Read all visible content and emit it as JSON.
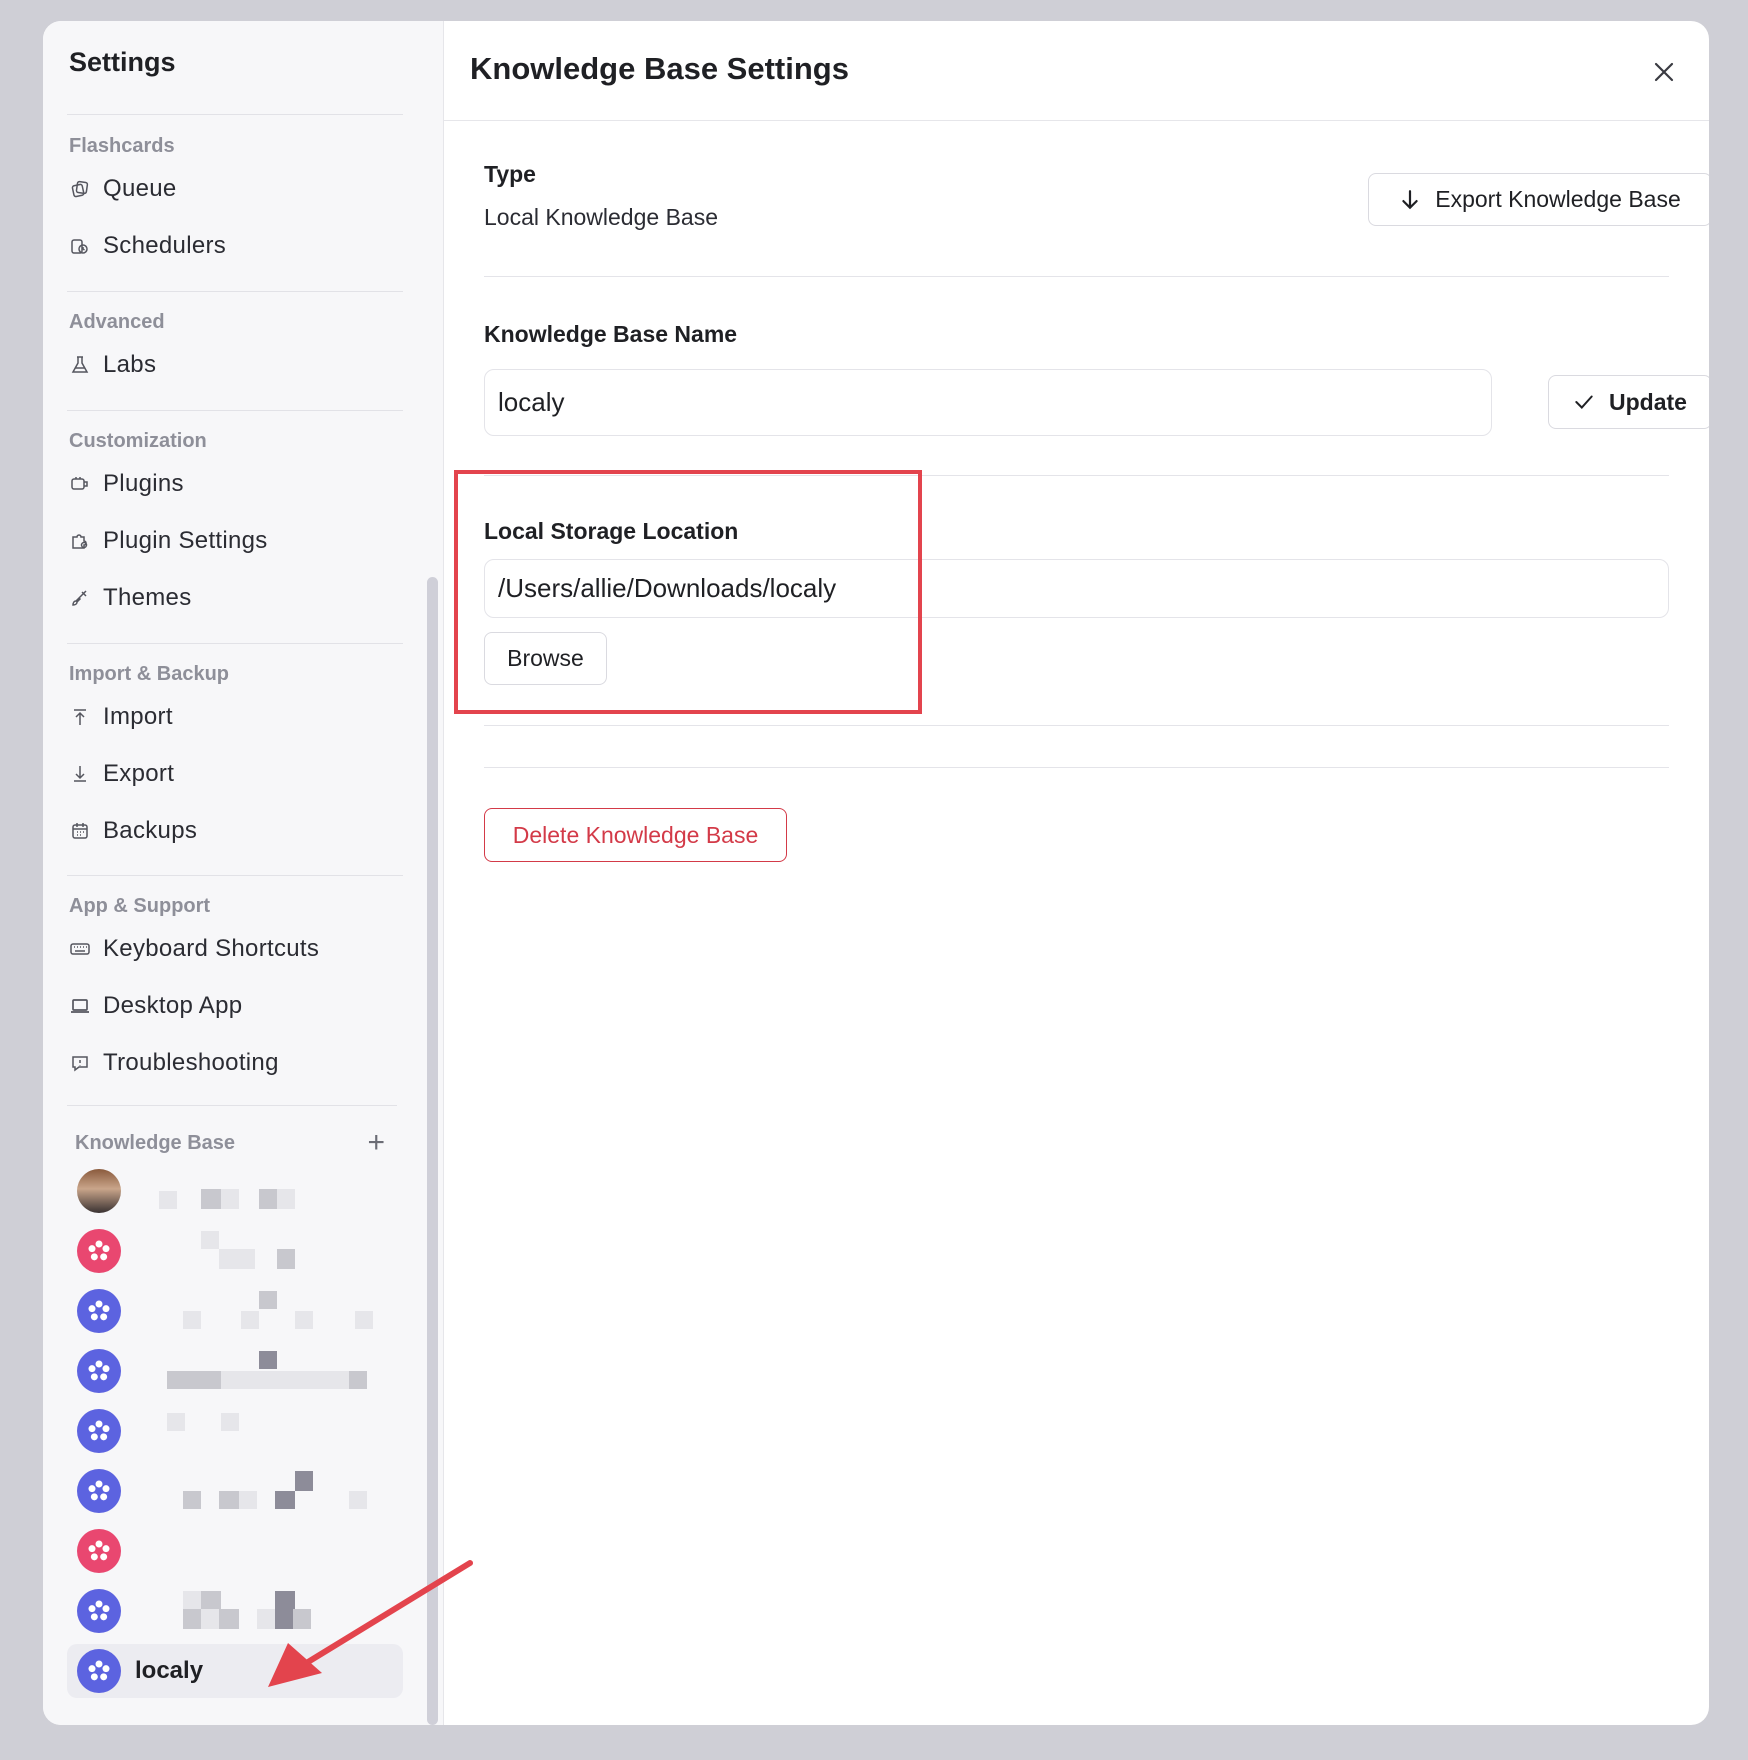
{
  "sidebar": {
    "title": "Settings",
    "groups": [
      {
        "label": "Flashcards",
        "items": [
          {
            "label": "Queue",
            "icon": "cards-icon"
          },
          {
            "label": "Schedulers",
            "icon": "scheduler-icon"
          }
        ]
      },
      {
        "label": "Advanced",
        "items": [
          {
            "label": "Labs",
            "icon": "flask-icon"
          }
        ]
      },
      {
        "label": "Customization",
        "items": [
          {
            "label": "Plugins",
            "icon": "plug-icon"
          },
          {
            "label": "Plugin Settings",
            "icon": "puzzle-gear-icon"
          },
          {
            "label": "Themes",
            "icon": "brush-icon"
          }
        ]
      },
      {
        "label": "Import & Backup",
        "items": [
          {
            "label": "Import",
            "icon": "arrow-up-icon"
          },
          {
            "label": "Export",
            "icon": "arrow-down-icon"
          },
          {
            "label": "Backups",
            "icon": "calendar-icon"
          }
        ]
      },
      {
        "label": "App & Support",
        "items": [
          {
            "label": "Keyboard Shortcuts",
            "icon": "keyboard-icon"
          },
          {
            "label": "Desktop App",
            "icon": "laptop-icon"
          },
          {
            "label": "Troubleshooting",
            "icon": "help-bubble-icon"
          }
        ]
      }
    ],
    "knowledge_base": {
      "label": "Knowledge Base",
      "add_icon": "plus-icon",
      "active_name": "localy"
    }
  },
  "main": {
    "title": "Knowledge Base Settings",
    "close_icon": "close-icon",
    "type_label": "Type",
    "type_value": "Local Knowledge Base",
    "export_button": "Export Knowledge Base",
    "name_label": "Knowledge Base Name",
    "name_value": "localy",
    "update_button": "Update",
    "storage_label": "Local Storage Location",
    "storage_value": "/Users/allie/Downloads/localy",
    "browse_button": "Browse",
    "delete_button": "Delete Knowledge Base"
  },
  "colors": {
    "accent_blue": "#5c63e0",
    "accent_pink": "#e94770",
    "danger": "#d33a48",
    "highlight": "#e3444d"
  }
}
